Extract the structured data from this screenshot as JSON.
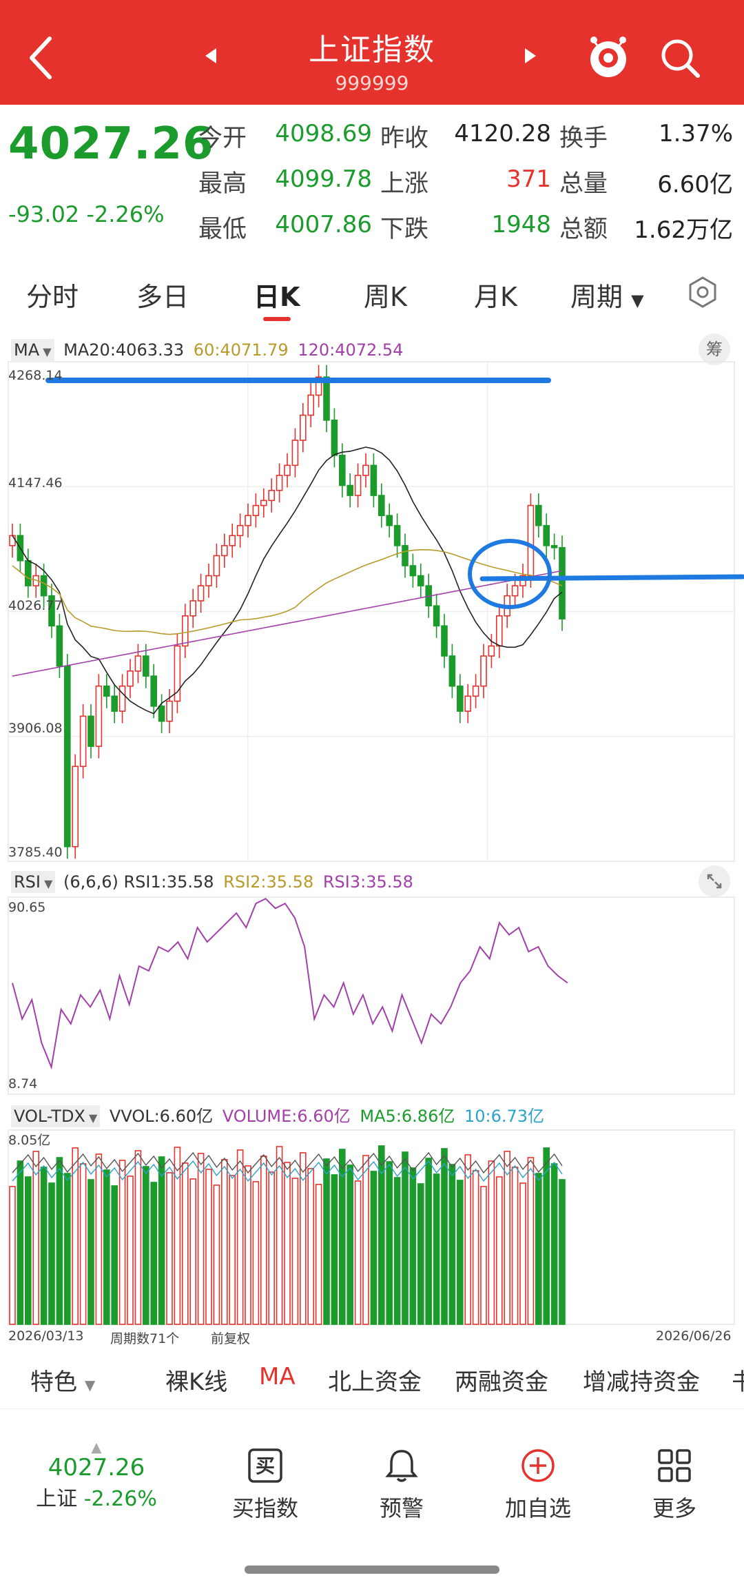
{
  "header": {
    "title": "上证指数",
    "code": "999999"
  },
  "quote": {
    "price": "4027.26",
    "change": "-93.02",
    "change_pct": "-2.26%",
    "rows": [
      [
        {
          "l": "今开",
          "v": "4098.69",
          "c": "green"
        },
        {
          "l": "昨收",
          "v": "4120.28",
          "c": "black"
        },
        {
          "l": "换手",
          "v": "1.37%",
          "c": "black"
        }
      ],
      [
        {
          "l": "最高",
          "v": "4099.78",
          "c": "green"
        },
        {
          "l": "上涨",
          "v": "371",
          "c": "red"
        },
        {
          "l": "总量",
          "v": "6.60亿",
          "c": "black"
        }
      ],
      [
        {
          "l": "最低",
          "v": "4007.86",
          "c": "green"
        },
        {
          "l": "下跌",
          "v": "1948",
          "c": "green"
        },
        {
          "l": "总额",
          "v": "1.62万亿",
          "c": "black"
        }
      ]
    ]
  },
  "tabs": [
    "分时",
    "多日",
    "日K",
    "周K",
    "月K",
    "周期"
  ],
  "active_tab": "日K",
  "main_chart": {
    "indicator": "MA",
    "ma20": "MA20:4063.33",
    "ma60": "60:4071.79",
    "ma120": "120:4072.54",
    "badge": "筹",
    "yticks": [
      "4268.14",
      "4147.46",
      "4026.77",
      "3906.08",
      "3785.40"
    ]
  },
  "rsi": {
    "indicator": "RSI",
    "params": "(6,6,6)",
    "rsi1": "RSI1:35.58",
    "rsi2": "RSI2:35.58",
    "rsi3": "RSI3:35.58",
    "ymax": "90.65",
    "ymin": "8.74"
  },
  "vol": {
    "indicator": "VOL-TDX",
    "vvol": "VVOL:6.60亿",
    "volume": "VOLUME:6.60亿",
    "ma5": "MA5:6.86亿",
    "ma10": "10:6.73亿",
    "ymax": "8.05亿"
  },
  "footer_axis": {
    "start": "2026/03/13",
    "period_count": "周期数71个",
    "adj": "前复权",
    "end": "2026/06/26"
  },
  "indicator_bar": [
    "特色",
    "裸K线",
    "MA",
    "北上资金",
    "两融资金",
    "增减持资金",
    "书"
  ],
  "bottom_nav": {
    "index_price": "4027.26",
    "index_label": "上证 -2.26%",
    "items": [
      "买指数",
      "预警",
      "加自选",
      "更多"
    ]
  },
  "colors": {
    "red": "#e5322d",
    "green": "#1a9b2b",
    "ma20": "#222222",
    "ma60": "#b89a2a",
    "ma120": "#a33fa8",
    "vol_ma10": "#2aa3c8",
    "annotation": "#1e7ae0"
  }
}
